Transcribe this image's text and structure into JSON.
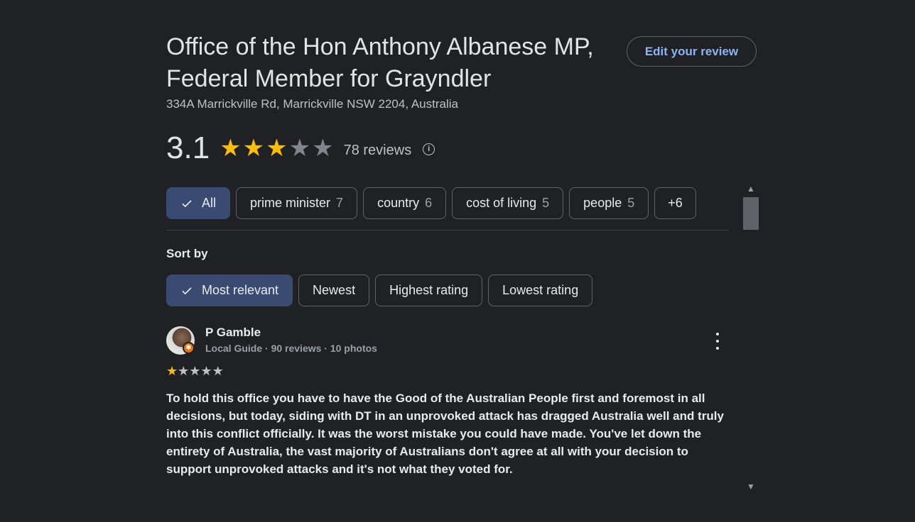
{
  "place": {
    "title_line1": "Office of the Hon Anthony Albanese MP,",
    "title_line2": "Federal Member for Grayndler",
    "address": "334A Marrickville Rd, Marrickville NSW 2204, Australia",
    "edit_review_label": "Edit your review"
  },
  "rating": {
    "value": "3.1",
    "stars_filled": 3,
    "stars_total": 5,
    "reviews_label": "78 reviews",
    "info_icon": "info-icon"
  },
  "topics": [
    {
      "label": "All",
      "count": "",
      "selected": true
    },
    {
      "label": "prime minister",
      "count": "7",
      "selected": false
    },
    {
      "label": "country",
      "count": "6",
      "selected": false
    },
    {
      "label": "cost of living",
      "count": "5",
      "selected": false
    },
    {
      "label": "people",
      "count": "5",
      "selected": false
    },
    {
      "label": "+6",
      "count": "",
      "selected": false
    }
  ],
  "sort": {
    "label": "Sort by",
    "options": [
      {
        "label": "Most relevant",
        "selected": true
      },
      {
        "label": "Newest",
        "selected": false
      },
      {
        "label": "Highest rating",
        "selected": false
      },
      {
        "label": "Lowest rating",
        "selected": false
      }
    ]
  },
  "review": {
    "name": "P Gamble",
    "meta": "Local Guide · 90 reviews · 10 photos",
    "stars_filled": 1,
    "stars_total": 5,
    "text": "To hold this office you have to have the Good of the Australian People first and foremost in all decisions, but today, siding with DT in an unprovoked attack has dragged Australia well and truly into this conflict officially. It was the worst mistake you could have made. You've let down the entirety of Australia, the vast majority of Australians don't agree at all with your decision to support unprovoked attacks and it's not what they voted for."
  },
  "colors": {
    "background": "#202124",
    "accent_link": "#8ab4f8",
    "star": "#fbbc04",
    "chip_selected": "#394b70",
    "local_guide_badge": "#e8710a"
  }
}
